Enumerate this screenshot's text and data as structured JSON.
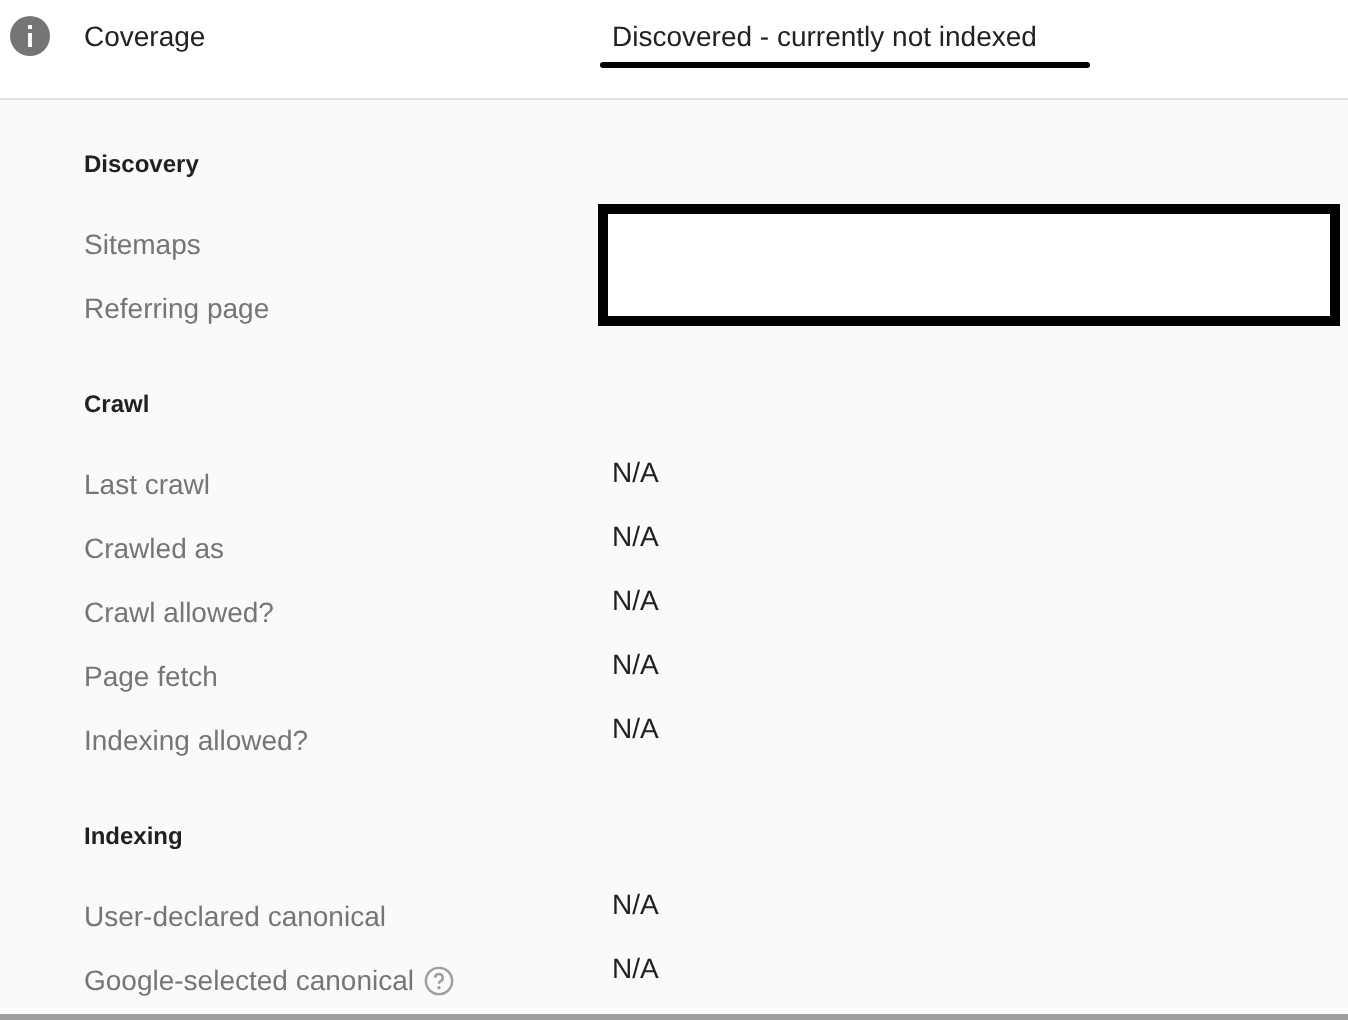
{
  "header": {
    "label": "Coverage",
    "value": "Discovered - currently not indexed",
    "underlined": true
  },
  "sections": [
    {
      "title": "Discovery",
      "redacted": true,
      "rows": [
        {
          "label": "Sitemaps"
        },
        {
          "label": "Referring page"
        }
      ]
    },
    {
      "title": "Crawl",
      "rows": [
        {
          "label": "Last crawl",
          "value": "N/A"
        },
        {
          "label": "Crawled as",
          "value": "N/A"
        },
        {
          "label": "Crawl allowed?",
          "value": "N/A"
        },
        {
          "label": "Page fetch",
          "value": "N/A"
        },
        {
          "label": "Indexing allowed?",
          "value": "N/A"
        }
      ]
    },
    {
      "title": "Indexing",
      "rows": [
        {
          "label": "User-declared canonical",
          "value": "N/A"
        },
        {
          "label": "Google-selected canonical",
          "value": "N/A",
          "help": true
        }
      ]
    }
  ]
}
